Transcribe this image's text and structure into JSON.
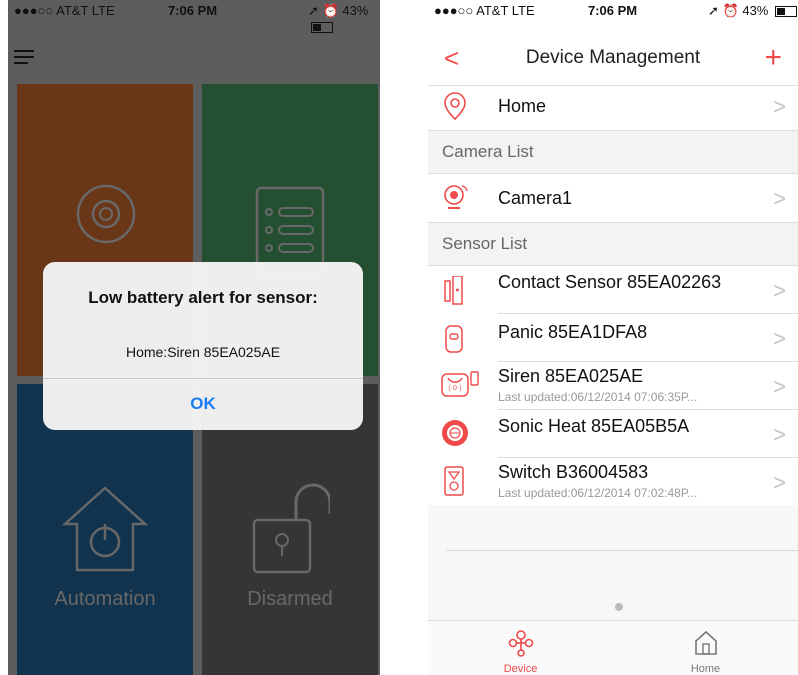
{
  "status_bar": {
    "carrier": "●●●○○ AT&T  LTE",
    "time": "7:06 PM",
    "battery": "43%"
  },
  "home_screen": {
    "tiles": [
      {
        "label": "Automation",
        "color": "#1b4f78"
      },
      {
        "label": "Disarmed",
        "color": "#505354"
      }
    ],
    "tile_colors": {
      "camera": "#a15324",
      "list": "#3a7a4c"
    }
  },
  "alert": {
    "title": "Low battery alert for sensor:",
    "message": "Home:Siren 85EA025AE",
    "ok_label": "OK"
  },
  "device_management": {
    "title": "Device Management",
    "back_label": "<",
    "add_label": "+",
    "home_row": "Home",
    "camera_section": "Camera List",
    "cameras": [
      "Camera1"
    ],
    "sensor_section": "Sensor List",
    "sensors": [
      {
        "name": "Contact Sensor 85EA02263",
        "sub": ""
      },
      {
        "name": "Panic 85EA1DFA8",
        "sub": ""
      },
      {
        "name": "Siren 85EA025AE",
        "sub": "Last updated:06/12/2014 07:06:35P..."
      },
      {
        "name": "Sonic Heat 85EA05B5A",
        "sub": ""
      },
      {
        "name": "Switch B36004583",
        "sub": "Last updated:06/12/2014 07:02:48P..."
      }
    ],
    "tabs": [
      {
        "label": "Device",
        "active": true
      },
      {
        "label": "Home",
        "active": false
      }
    ],
    "accent": "#f04a4a"
  }
}
